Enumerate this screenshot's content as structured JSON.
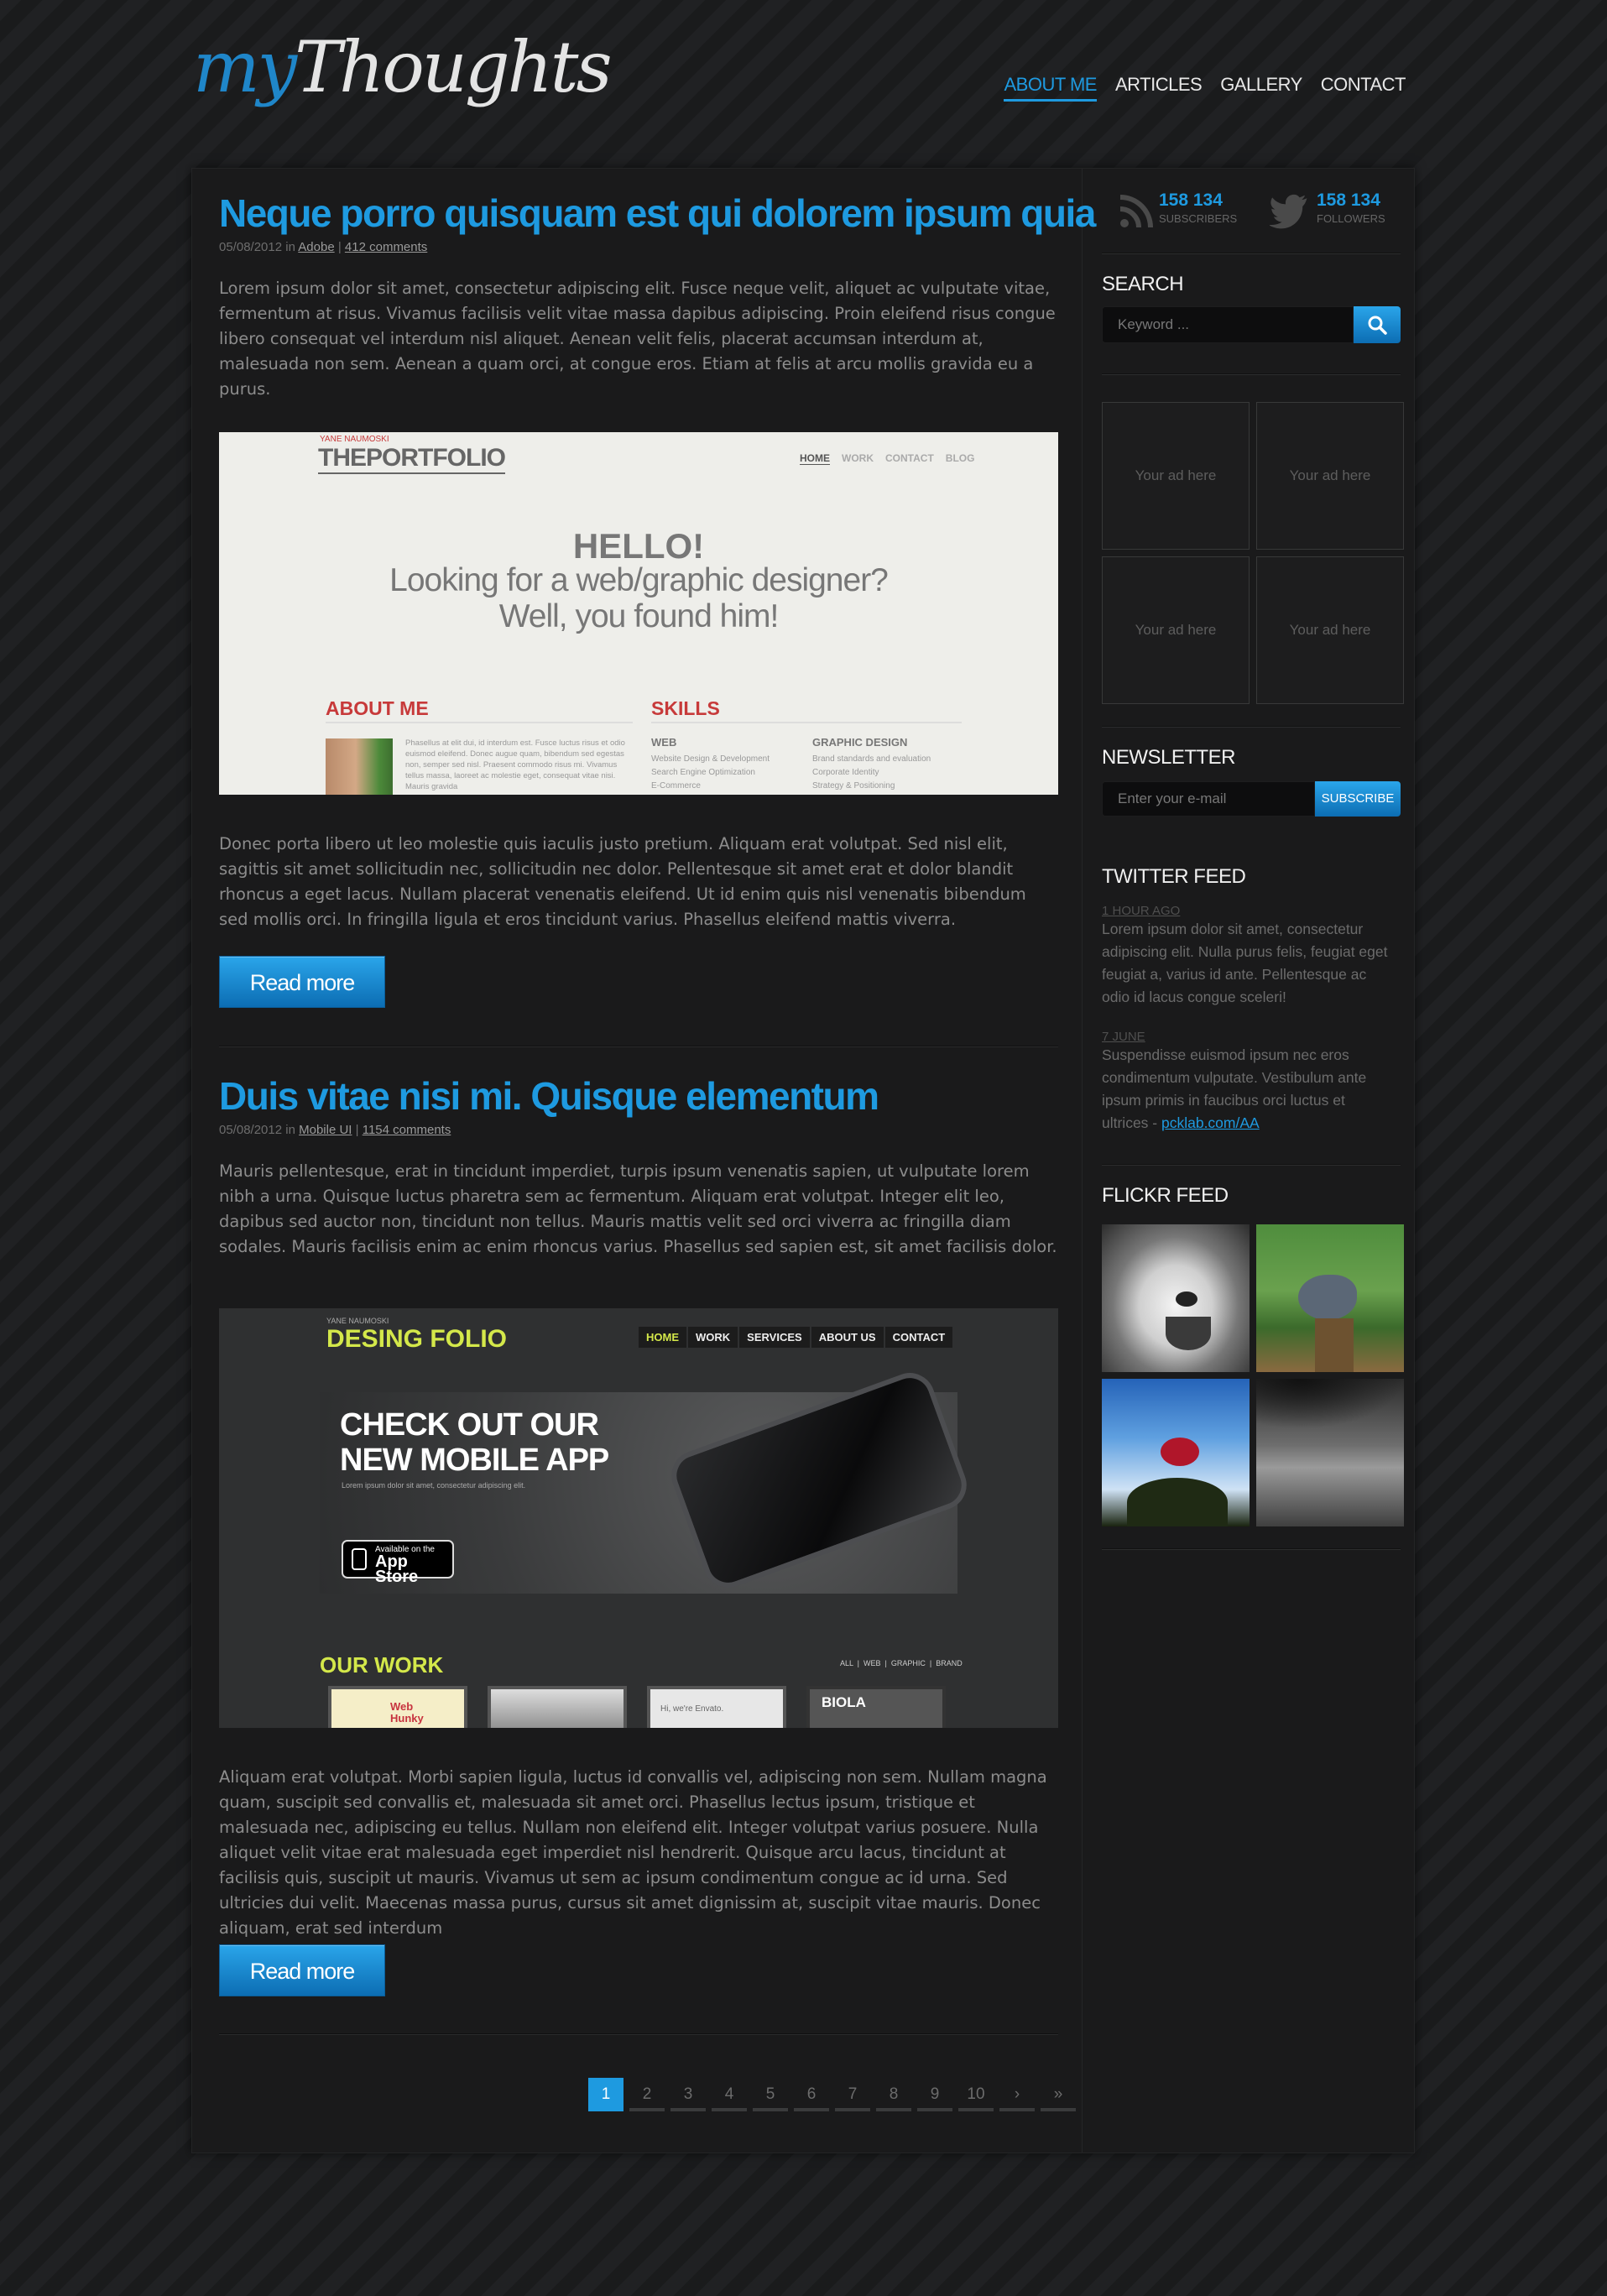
{
  "header": {
    "logo_my": "my",
    "logo_thoughts": "Thoughts",
    "nav": [
      "ABOUT ME",
      "ARTICLES",
      "GALLERY",
      "CONTACT"
    ]
  },
  "posts": [
    {
      "title": "Neque porro quisquam est qui dolorem ipsum quia",
      "date": "05/08/2012",
      "in": "in",
      "category": "Adobe",
      "sep": "|",
      "comments": "412 comments",
      "intro": "Lorem ipsum dolor sit amet, consectetur adipiscing elit. Fusce neque velit, aliquet ac vulputate vitae, fermentum at risus. Vivamus facilisis velit vitae massa dapibus adipiscing. Proin eleifend risus congue libero consequat vel interdum nisl aliquet. Aenean velit felis, placerat accumsan interdum at, malesuada non sem. Aenean a quam orci, at congue eros. Etiam at felis at arcu mollis gravida eu a purus.",
      "outro": "Donec porta libero ut leo molestie quis iaculis justo pretium. Aliquam erat volutpat. Sed nisl elit, sagittis sit amet sollicitudin nec, sollicitudin nec dolor. Pellentesque sit amet erat et dolor blandit rhoncus a eget lacus. Nullam placerat venenatis eleifend. Ut id enim quis nisl venenatis bibendum sed mollis orci.  In fringilla ligula et eros tincidunt varius. Phasellus eleifend mattis viverra.",
      "read_more": "Read more",
      "image": {
        "author": "YANE NAUMOSKI",
        "brand": "THEPORTFOLIO",
        "nav": [
          "HOME",
          "WORK",
          "CONTACT",
          "BLOG"
        ],
        "hello": "HELLO!",
        "line1": "Looking for a web/graphic designer?",
        "line2": "Well, you found him!",
        "about_title": "ABOUT ME",
        "about_text": "Phasellus at elit dui, id interdum est. Fusce luctus risus et odio euismod eleifend. Donec augue quam, bibendum sed egestas non, semper sed nisl. Praesent commodo risus mi. Vivamus tellus massa, laoreet ac molestie eget, consequat vitae nisi. Mauris gravida",
        "skills_title": "SKILLS",
        "web_title": "WEB",
        "web_items": [
          "Website Design & Development",
          "Search Engine Optimization",
          "E-Commerce"
        ],
        "gd_title": "GRAPHIC DESIGN",
        "gd_items": [
          "Brand standards and evaluation",
          "Corporate Identity",
          "Strategy & Positioning"
        ]
      }
    },
    {
      "title": "Duis vitae nisi mi. Quisque elementum",
      "date": "05/08/2012",
      "in": "in",
      "category": "Mobile UI",
      "sep": "|",
      "comments": "1154 comments",
      "intro": "Mauris pellentesque, erat in tincidunt imperdiet, turpis ipsum venenatis sapien, ut vulputate lorem nibh a urna. Quisque luctus pharetra sem ac fermentum. Aliquam erat volutpat. Integer elit leo, dapibus sed auctor non, tincidunt non tellus. Mauris mattis velit sed orci viverra ac fringilla diam sodales. Mauris facilisis enim ac enim rhoncus varius. Phasellus sed sapien est, sit amet facilisis dolor.",
      "outro": "Aliquam erat volutpat. Morbi sapien ligula, luctus id convallis vel, adipiscing non sem. Nullam magna quam, suscipit sed convallis et, malesuada sit amet orci. Phasellus lectus ipsum, tristique et malesuada nec, adipiscing eu tellus. Nullam non eleifend elit. Integer volutpat varius posuere. Nulla aliquet velit vitae erat malesuada eget imperdiet nisl hendrerit. Quisque arcu lacus, tincidunt at facilisis quis, suscipit ut mauris. Vivamus ut sem ac ipsum condimentum congue ac id urna. Sed ultricies dui velit. Maecenas massa purus, cursus sit amet dignissim at, suscipit vitae mauris. Donec aliquam, erat sed interdum",
      "read_more": "Read more",
      "image": {
        "author": "YANE NAUMOSKI",
        "brand": "DESING FOLIO",
        "nav": [
          "HOME",
          "WORK",
          "SERVICES",
          "ABOUT US",
          "CONTACT"
        ],
        "hero1": "CHECK OUT OUR",
        "hero2": "NEW MOBILE APP",
        "hero_sub": "Lorem ipsum dolor sit amet, consectetur adipiscing elit.",
        "appstore_small": "Available on the",
        "appstore_big": "App Store",
        "our_work": "OUR WORK",
        "filters": "ALL  |  WEB  |  GRAPHIC  |  BRAND",
        "thumb1": "Web Hunky",
        "thumb3": "Hi, we're Envato.",
        "thumb4": "BIOLA"
      }
    }
  ],
  "pagination": [
    "1",
    "2",
    "3",
    "4",
    "5",
    "6",
    "7",
    "8",
    "9",
    "10",
    "›",
    "»"
  ],
  "sidebar": {
    "rss_count": "158 134",
    "rss_label": "SUBSCRIBERS",
    "twitter_count": "158 134",
    "twitter_label": "FOLLOWERS",
    "search_title": "SEARCH",
    "search_placeholder": "Keyword ...",
    "ads": [
      "Your ad here",
      "Your ad here",
      "Your ad here",
      "Your ad here"
    ],
    "newsletter_title": "NEWSLETTER",
    "newsletter_placeholder": "Enter your e-mail",
    "subscribe_label": "SUBSCRIBE",
    "twitter_title": "TWITTER FEED",
    "tweets": [
      {
        "date": "1 HOUR AGO",
        "text": "Lorem ipsum dolor sit amet, consectetur adipiscing elit. Nulla purus felis, feugiat eget feugiat a, varius id ante. Pellentesque ac odio id lacus congue sceleri!",
        "link": ""
      },
      {
        "date": "7 JUNE",
        "text": "Suspendisse euismod ipsum nec eros condimentum vulputate. Vestibulum ante ipsum primis in faucibus orci luctus et ultrices - ",
        "link": "pcklab.com/AA"
      }
    ],
    "flickr_title": "FLICKR FEED"
  },
  "colors": {
    "accent": "#1e9ae0",
    "background": "#1b1c1e",
    "panel": "#1a1a1b"
  }
}
